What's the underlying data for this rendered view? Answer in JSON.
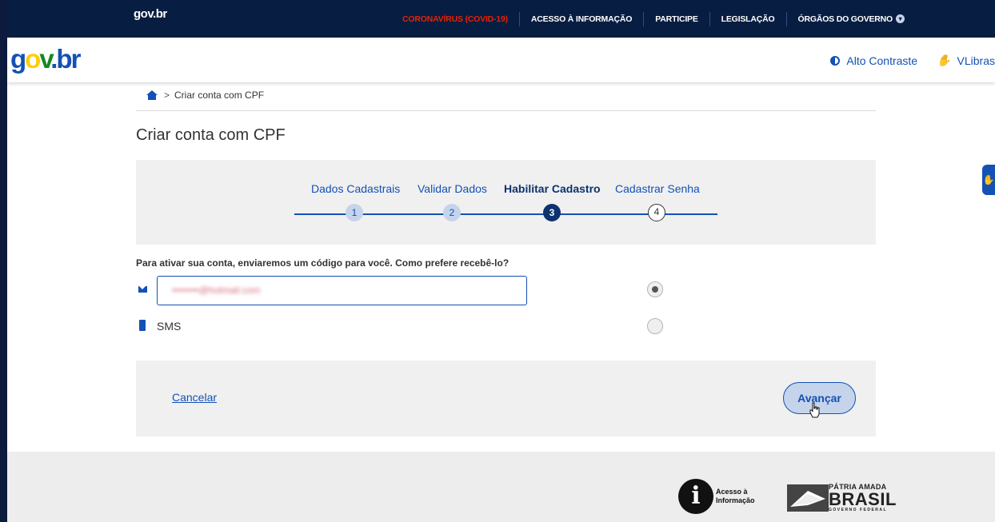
{
  "topbar": {
    "brand": "gov.br",
    "nav": [
      {
        "label": "CORONAVÍRUS (COVID-19)",
        "highlight": true
      },
      {
        "label": "ACESSO À INFORMAÇÃO"
      },
      {
        "label": "PARTICIPE"
      },
      {
        "label": "LEGISLAÇÃO"
      },
      {
        "label": "ÓRGÃOS DO GOVERNO"
      }
    ]
  },
  "header": {
    "logo": {
      "p1": "g",
      "p2": "o",
      "p3": "v",
      "p4": ".br"
    },
    "contrast_label": "Alto Contraste",
    "libras_label": "VLibras"
  },
  "breadcrumb": {
    "current": "Criar conta com CPF",
    "separator": ">"
  },
  "page_title": "Criar conta com CPF",
  "steps": [
    {
      "label": "Dados Cadastrais",
      "number": "1",
      "state": "done"
    },
    {
      "label": "Validar Dados",
      "number": "2",
      "state": "done"
    },
    {
      "label": "Habilitar Cadastro",
      "number": "3",
      "state": "active"
    },
    {
      "label": "Cadastrar Senha",
      "number": "4",
      "state": "todo"
    }
  ],
  "form": {
    "question": "Para ativar sua conta, enviaremos um código para você. Como prefere recebê-lo?",
    "email_value": "••••••••@hotmail.com",
    "email_selected": true,
    "sms_label": "SMS",
    "sms_selected": false
  },
  "actions": {
    "cancel_label": "Cancelar",
    "next_label": "Avançar"
  },
  "footer": {
    "acesso_line1": "Acesso à",
    "acesso_line2": "Informação",
    "brasil_line1": "PÁTRIA AMADA",
    "brasil_line2": "BRASIL",
    "brasil_line3": "GOVERNO FEDERAL"
  },
  "colors": {
    "primary": "#1351b4",
    "navy": "#071d41",
    "alert": "#e52207"
  }
}
